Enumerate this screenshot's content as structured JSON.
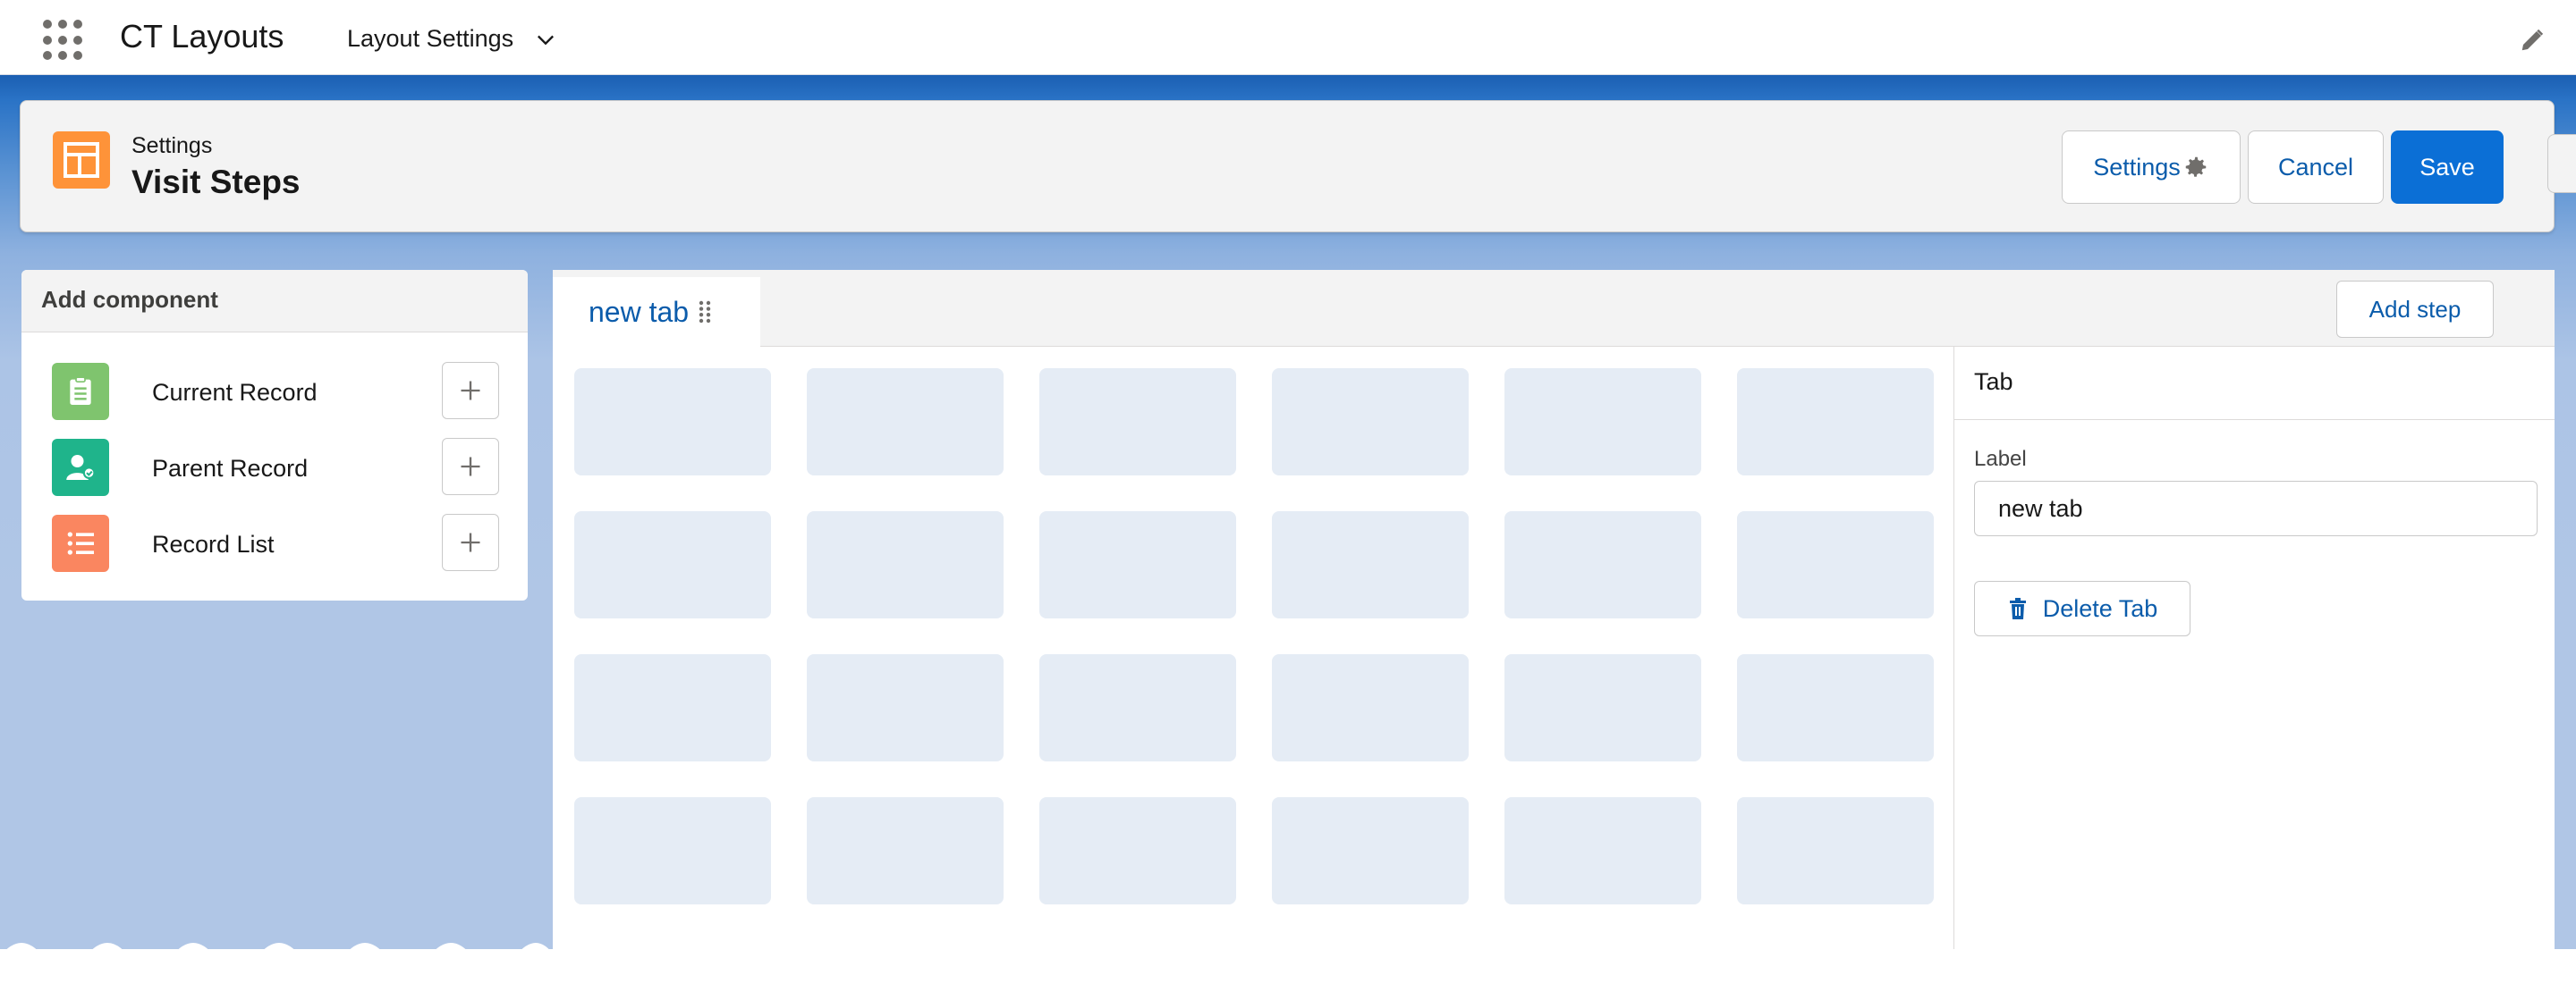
{
  "topnav": {
    "app_name": "CT Layouts",
    "nav_item": "Layout Settings"
  },
  "header": {
    "subtitle": "Settings",
    "title": "Visit Steps",
    "settings_label": "Settings",
    "cancel_label": "Cancel",
    "save_label": "Save"
  },
  "left_panel": {
    "title": "Add component",
    "items": [
      {
        "label": "Current Record",
        "icon": "clipboard-icon",
        "color": "#7fc46e"
      },
      {
        "label": "Parent Record",
        "icon": "user-group-icon",
        "color": "#1fb48b"
      },
      {
        "label": "Record List",
        "icon": "list-icon",
        "color": "#fa8660"
      }
    ]
  },
  "main": {
    "tab_label": "new tab",
    "add_step_label": "Add step"
  },
  "props": {
    "title": "Tab",
    "label_caption": "Label",
    "label_value": "new tab",
    "delete_label": "Delete Tab"
  },
  "colors": {
    "brand_blue": "#0b6fd6",
    "link_blue": "#0b5cab",
    "header_icon": "#fe9339"
  }
}
